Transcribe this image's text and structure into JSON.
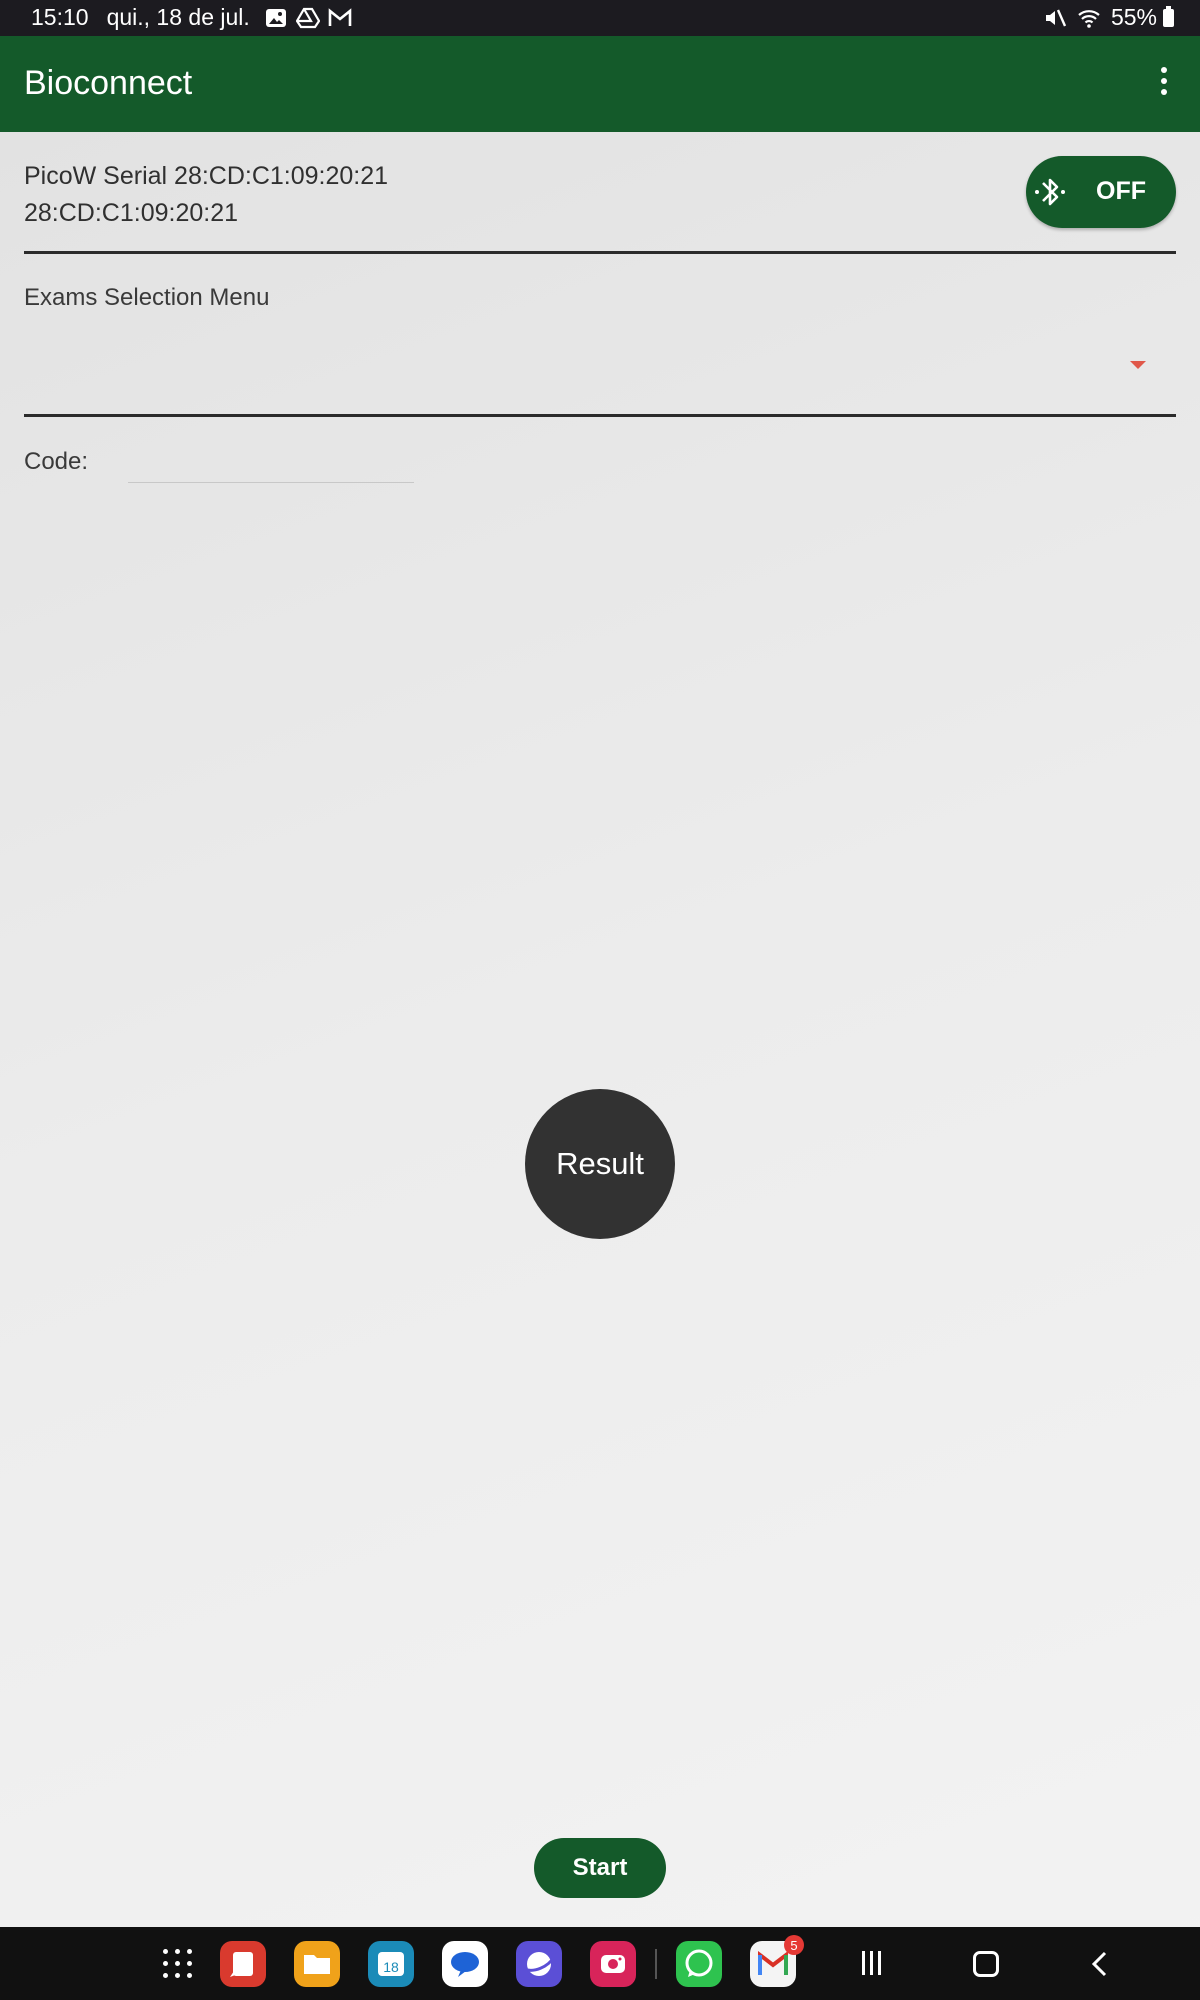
{
  "status_bar": {
    "time": "15:10",
    "date": "qui., 18 de jul.",
    "battery": "55%",
    "left_icons": [
      "gallery-icon",
      "drive-icon",
      "gmail-icon"
    ],
    "right_icons": [
      "mute-icon",
      "wifi-icon",
      "battery-icon"
    ]
  },
  "app_bar": {
    "title": "Bioconnect",
    "menu_icon": "more-vert-icon"
  },
  "device": {
    "line1": "PicoW Serial 28:CD:C1:09:20:21",
    "line2": "28:CD:C1:09:20:21",
    "toggle_label": "OFF",
    "toggle_icon": "bluetooth-icon"
  },
  "exams": {
    "label": "Exams Selection Menu",
    "selected": ""
  },
  "code": {
    "label": "Code:",
    "value": ""
  },
  "result_button": "Result",
  "start_button": "Start",
  "taskbar": {
    "apps": [
      {
        "name": "apps-grid-icon"
      },
      {
        "name": "notes-app-icon",
        "color": "#d93a2e"
      },
      {
        "name": "files-app-icon",
        "color": "#f0a21a"
      },
      {
        "name": "calendar-app-icon",
        "color": "#1b8bb8",
        "text": "18"
      },
      {
        "name": "messages-app-icon",
        "color": "#ffffff"
      },
      {
        "name": "browser-app-icon",
        "color": "#5b4fd6"
      },
      {
        "name": "camera-app-icon",
        "color": "#d8245a"
      },
      {
        "name": "whatsapp-app-icon",
        "color": "#2ec34f"
      },
      {
        "name": "gmail-app-icon",
        "color": "#f4f4f4",
        "badge": "5"
      }
    ]
  },
  "colors": {
    "primary": "#145a2a",
    "status_bar": "#1c1b20",
    "result_button": "#323232",
    "dropdown_caret": "#e0584a"
  }
}
